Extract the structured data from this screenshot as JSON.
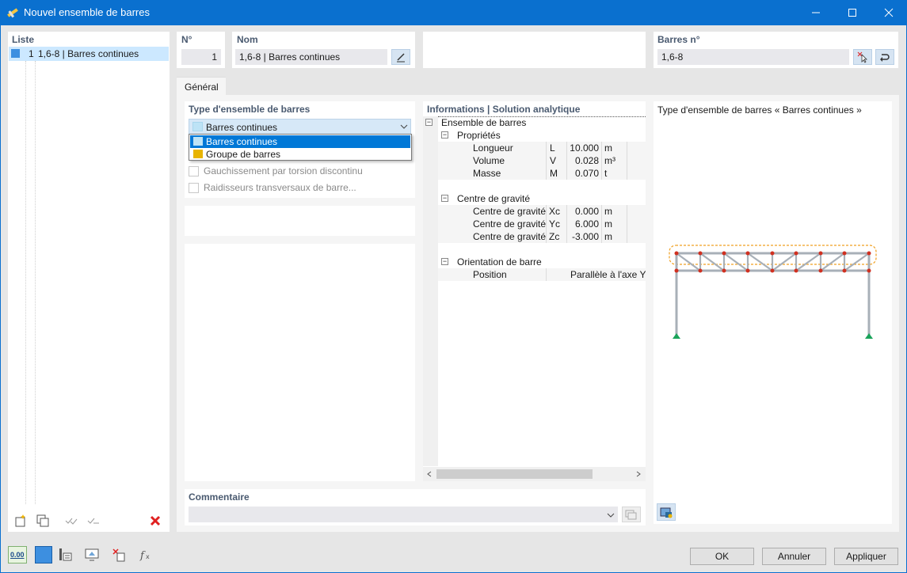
{
  "window": {
    "title": "Nouvel ensemble de barres",
    "minimize": "—",
    "maximize": "☐",
    "close": "✕"
  },
  "list": {
    "header": "Liste",
    "items": [
      {
        "num": "1",
        "label": "1,6-8 | Barres continues",
        "color": "#3d8fe0"
      }
    ]
  },
  "header": {
    "no_label": "N°",
    "no_value": "1",
    "name_label": "Nom",
    "name_value": "1,6-8 | Barres continues",
    "members_label": "Barres n°",
    "members_value": "1,6-8"
  },
  "tabs": [
    "Général"
  ],
  "type_section": {
    "label": "Type d'ensemble de barres",
    "selected": "Barres continues",
    "options": [
      {
        "label": "Barres continues",
        "color": "#bde3f6"
      },
      {
        "label": "Groupe de barres",
        "color": "#e8b400"
      }
    ],
    "checkboxes": [
      {
        "label": "Gauchissement par torsion discontinu",
        "checked": false
      },
      {
        "label": "Raidisseurs transversaux de barre...",
        "checked": false
      }
    ]
  },
  "info": {
    "header": "Informations | Solution analytique",
    "root": "Ensemble de barres",
    "groups": [
      {
        "name": "Propriétés",
        "rows": [
          {
            "name": "Longueur",
            "sym": "L",
            "value": "10.000",
            "unit": "m"
          },
          {
            "name": "Volume",
            "sym": "V",
            "value": "0.028",
            "unit": "m³"
          },
          {
            "name": "Masse",
            "sym": "M",
            "value": "0.070",
            "unit": "t"
          }
        ]
      },
      {
        "name": "Centre de gravité",
        "rows": [
          {
            "name": "Centre de gravité",
            "sym": "Xc",
            "value": "0.000",
            "unit": "m"
          },
          {
            "name": "Centre de gravité",
            "sym": "Yc",
            "value": "6.000",
            "unit": "m"
          },
          {
            "name": "Centre de gravité",
            "sym": "Zc",
            "value": "-3.000",
            "unit": "m"
          }
        ]
      },
      {
        "name": "Orientation de barre",
        "rows": [
          {
            "name": "Position",
            "sym": "",
            "value": "Parallèle à l'axe Y d",
            "unit": ""
          }
        ]
      }
    ]
  },
  "preview": {
    "title": "Type d'ensemble de barres « Barres continues »"
  },
  "comment": {
    "label": "Commentaire",
    "value": ""
  },
  "bottom": {
    "ok": "OK",
    "cancel": "Annuler",
    "apply": "Appliquer",
    "units_badge": "0.00"
  },
  "colors": {
    "titlebar": "#0a70cf",
    "selection": "#0078d7",
    "list_selected": "#cce8ff",
    "truss": "#a8b0b8",
    "node": "#d03020",
    "support": "#1aa35a",
    "highlight": "#f0a020"
  }
}
